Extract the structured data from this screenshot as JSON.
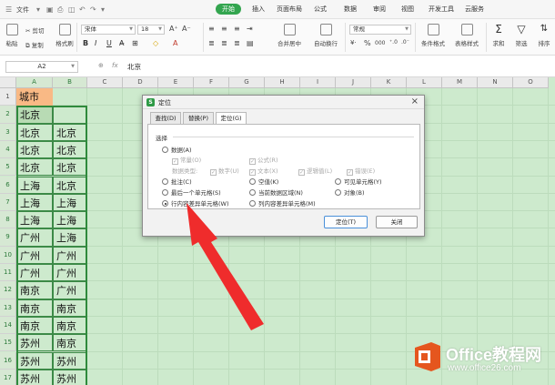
{
  "menubar": {
    "file_label": "文件",
    "tabs": [
      {
        "label": "开始",
        "active": true
      },
      {
        "label": "插入",
        "active": false
      },
      {
        "label": "页面布局",
        "active": false
      },
      {
        "label": "公式",
        "active": false
      },
      {
        "label": "数据",
        "active": false
      },
      {
        "label": "审阅",
        "active": false
      },
      {
        "label": "视图",
        "active": false
      },
      {
        "label": "开发工具",
        "active": false
      },
      {
        "label": "云服务",
        "active": false
      }
    ],
    "accent": "#33a54f"
  },
  "ribbon": {
    "paste": "粘贴",
    "cut": "剪切",
    "copy": "复制",
    "format_painter": "格式刷",
    "font_name": "宋体",
    "font_size": "18",
    "merge_center": "合并居中",
    "wrap_text": "自动换行",
    "number_format": "常规",
    "percent": "%",
    "thousand": "000",
    "cond_format": "条件格式",
    "table_style": "表格样式",
    "sum": "求和",
    "filter": "筛选",
    "sort": "排序"
  },
  "formula_bar": {
    "name_box": "A2",
    "fx": "fx",
    "value": "北京"
  },
  "grid": {
    "columns": [
      "A",
      "B",
      "C",
      "D",
      "E",
      "F",
      "G",
      "H",
      "I",
      "J",
      "K",
      "L",
      "M",
      "N",
      "O"
    ],
    "rows": [
      "1",
      "2",
      "3",
      "4",
      "5",
      "6",
      "7",
      "8",
      "9",
      "10",
      "11",
      "12",
      "13",
      "14",
      "15",
      "16",
      "17"
    ],
    "cells": [
      [
        "城市",
        ""
      ],
      [
        "北京",
        ""
      ],
      [
        "北京",
        "北京"
      ],
      [
        "北京",
        "北京"
      ],
      [
        "北京",
        "北京"
      ],
      [
        "上海",
        "北京"
      ],
      [
        "上海",
        "上海"
      ],
      [
        "上海",
        "上海"
      ],
      [
        "广州",
        "上海"
      ],
      [
        "广州",
        "广州"
      ],
      [
        "广州",
        "广州"
      ],
      [
        "南京",
        "广州"
      ],
      [
        "南京",
        "南京"
      ],
      [
        "南京",
        "南京"
      ],
      [
        "苏州",
        "南京"
      ],
      [
        "苏州",
        "苏州"
      ],
      [
        "苏州",
        "苏州"
      ]
    ]
  },
  "dialog": {
    "title": "定位",
    "tabs": [
      "查找(D)",
      "替换(P)",
      "定位(G)"
    ],
    "active_tab": 2,
    "group_label": "选择",
    "options": {
      "data": "数据(A)",
      "constant": "常量(O)",
      "formula": "公式(R)",
      "data_type": "数据类型:",
      "number": "数字(U)",
      "text": "文本(X)",
      "logical": "逻辑值(L)",
      "error": "错误(E)",
      "comment": "批注(C)",
      "blank": "空值(K)",
      "visible": "可见单元格(Y)",
      "last_cell": "最后一个单元格(S)",
      "current_region": "当前数据区域(N)",
      "object": "对象(B)",
      "row_diff": "行内容差异单元格(W)",
      "col_diff": "列内容差异单元格(M)"
    },
    "selected_option": "row_diff",
    "locate_button": "定位(T)",
    "close_button": "关闭"
  },
  "watermark": {
    "line1": "Office教程网",
    "line2": "www.office26.com",
    "color": "#e5561e"
  }
}
